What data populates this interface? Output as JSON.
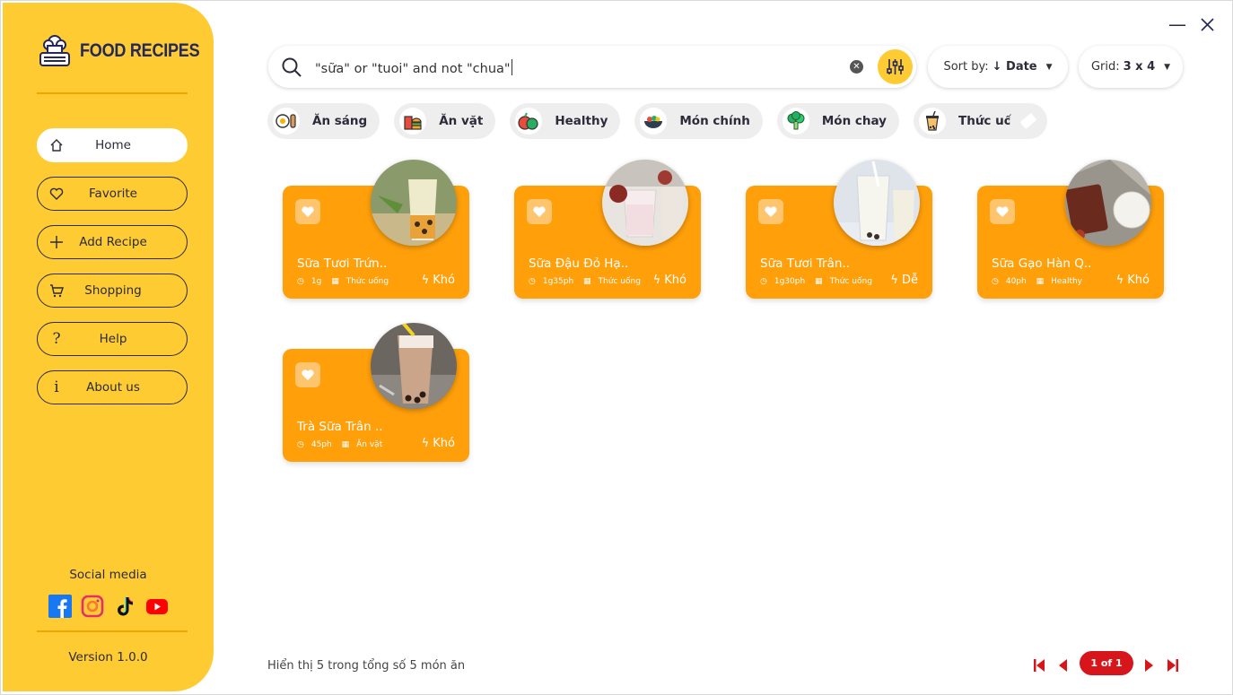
{
  "app": {
    "title": "FOOD RECIPES",
    "version": "Version 1.0.0"
  },
  "sidebar": {
    "items": [
      {
        "label": "Home",
        "icon": "home-icon",
        "active": true
      },
      {
        "label": "Favorite",
        "icon": "heart-icon"
      },
      {
        "label": "Add Recipe",
        "icon": "plus-icon"
      },
      {
        "label": "Shopping",
        "icon": "cart-icon"
      },
      {
        "label": "Help",
        "icon": "question-icon"
      },
      {
        "label": "About us",
        "icon": "info-icon"
      }
    ],
    "social_title": "Social media",
    "social": [
      "facebook-icon",
      "instagram-icon",
      "tiktok-icon",
      "youtube-icon"
    ]
  },
  "search": {
    "value": "\"sữa\" or \"tuoi\" and not \"chua\""
  },
  "sort": {
    "label": "Sort by:",
    "value": "↓ Date"
  },
  "grid": {
    "label": "Grid:",
    "value": "3 x 4"
  },
  "categories": [
    {
      "label": "Ăn sáng",
      "icon": "breakfast-icon"
    },
    {
      "label": "Ăn vặt",
      "icon": "fastfood-icon"
    },
    {
      "label": "Healthy",
      "icon": "vegetables-icon"
    },
    {
      "label": "Món chính",
      "icon": "main-dish-icon"
    },
    {
      "label": "Món chay",
      "icon": "broccoli-icon"
    },
    {
      "label": "Thức uống",
      "icon": "bubble-tea-icon"
    }
  ],
  "recipes": [
    {
      "title": "Sữa Tươi Trứn..",
      "time": "1g",
      "category": "Thức uống",
      "level": "Khó"
    },
    {
      "title": "Sữa Đậu Đỏ Hạ..",
      "time": "1g35ph",
      "category": "Thức uống",
      "level": "Khó"
    },
    {
      "title": "Sữa Tươi Trân..",
      "time": "1g30ph",
      "category": "Thức uống",
      "level": "Dễ"
    },
    {
      "title": "Sữa Gạo Hàn Q..",
      "time": "40ph",
      "category": "Healthy",
      "level": "Khó"
    },
    {
      "title": "Trà Sữa Trân ..",
      "time": "45ph",
      "category": "Ăn vặt",
      "level": "Khó"
    }
  ],
  "footer": {
    "summary": "Hiển thị 5 trong tổng số 5 món ăn",
    "page": "1 of 1"
  },
  "colors": {
    "sidebar": "#fecb33",
    "card": "#ff9f0a",
    "navy": "#25285a",
    "pager": "#d7161c"
  }
}
